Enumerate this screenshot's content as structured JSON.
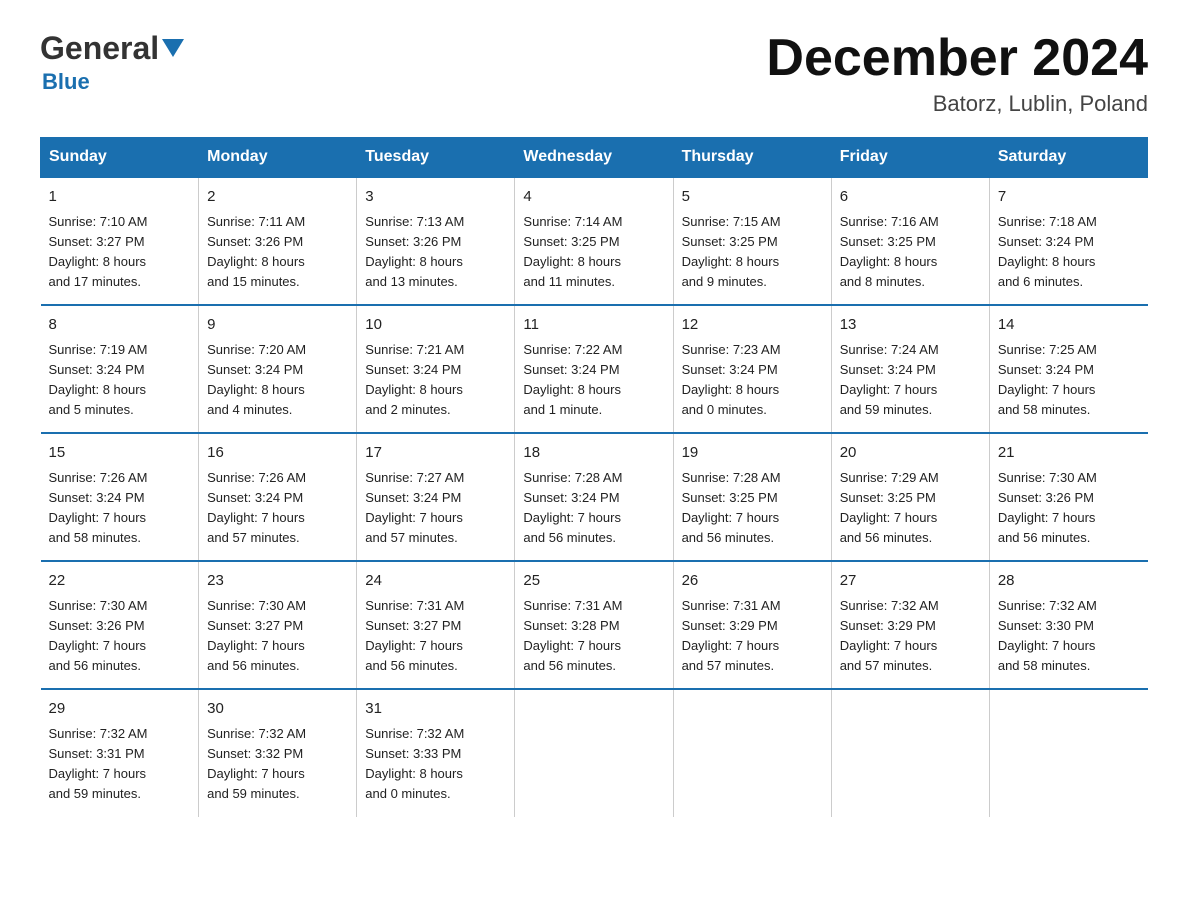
{
  "header": {
    "logo_general": "General",
    "logo_blue": "Blue",
    "month_title": "December 2024",
    "location": "Batorz, Lublin, Poland"
  },
  "days_of_week": [
    "Sunday",
    "Monday",
    "Tuesday",
    "Wednesday",
    "Thursday",
    "Friday",
    "Saturday"
  ],
  "weeks": [
    [
      {
        "day": "1",
        "sunrise": "7:10 AM",
        "sunset": "3:27 PM",
        "daylight": "8 hours and 17 minutes."
      },
      {
        "day": "2",
        "sunrise": "7:11 AM",
        "sunset": "3:26 PM",
        "daylight": "8 hours and 15 minutes."
      },
      {
        "day": "3",
        "sunrise": "7:13 AM",
        "sunset": "3:26 PM",
        "daylight": "8 hours and 13 minutes."
      },
      {
        "day": "4",
        "sunrise": "7:14 AM",
        "sunset": "3:25 PM",
        "daylight": "8 hours and 11 minutes."
      },
      {
        "day": "5",
        "sunrise": "7:15 AM",
        "sunset": "3:25 PM",
        "daylight": "8 hours and 9 minutes."
      },
      {
        "day": "6",
        "sunrise": "7:16 AM",
        "sunset": "3:25 PM",
        "daylight": "8 hours and 8 minutes."
      },
      {
        "day": "7",
        "sunrise": "7:18 AM",
        "sunset": "3:24 PM",
        "daylight": "8 hours and 6 minutes."
      }
    ],
    [
      {
        "day": "8",
        "sunrise": "7:19 AM",
        "sunset": "3:24 PM",
        "daylight": "8 hours and 5 minutes."
      },
      {
        "day": "9",
        "sunrise": "7:20 AM",
        "sunset": "3:24 PM",
        "daylight": "8 hours and 4 minutes."
      },
      {
        "day": "10",
        "sunrise": "7:21 AM",
        "sunset": "3:24 PM",
        "daylight": "8 hours and 2 minutes."
      },
      {
        "day": "11",
        "sunrise": "7:22 AM",
        "sunset": "3:24 PM",
        "daylight": "8 hours and 1 minute."
      },
      {
        "day": "12",
        "sunrise": "7:23 AM",
        "sunset": "3:24 PM",
        "daylight": "8 hours and 0 minutes."
      },
      {
        "day": "13",
        "sunrise": "7:24 AM",
        "sunset": "3:24 PM",
        "daylight": "7 hours and 59 minutes."
      },
      {
        "day": "14",
        "sunrise": "7:25 AM",
        "sunset": "3:24 PM",
        "daylight": "7 hours and 58 minutes."
      }
    ],
    [
      {
        "day": "15",
        "sunrise": "7:26 AM",
        "sunset": "3:24 PM",
        "daylight": "7 hours and 58 minutes."
      },
      {
        "day": "16",
        "sunrise": "7:26 AM",
        "sunset": "3:24 PM",
        "daylight": "7 hours and 57 minutes."
      },
      {
        "day": "17",
        "sunrise": "7:27 AM",
        "sunset": "3:24 PM",
        "daylight": "7 hours and 57 minutes."
      },
      {
        "day": "18",
        "sunrise": "7:28 AM",
        "sunset": "3:24 PM",
        "daylight": "7 hours and 56 minutes."
      },
      {
        "day": "19",
        "sunrise": "7:28 AM",
        "sunset": "3:25 PM",
        "daylight": "7 hours and 56 minutes."
      },
      {
        "day": "20",
        "sunrise": "7:29 AM",
        "sunset": "3:25 PM",
        "daylight": "7 hours and 56 minutes."
      },
      {
        "day": "21",
        "sunrise": "7:30 AM",
        "sunset": "3:26 PM",
        "daylight": "7 hours and 56 minutes."
      }
    ],
    [
      {
        "day": "22",
        "sunrise": "7:30 AM",
        "sunset": "3:26 PM",
        "daylight": "7 hours and 56 minutes."
      },
      {
        "day": "23",
        "sunrise": "7:30 AM",
        "sunset": "3:27 PM",
        "daylight": "7 hours and 56 minutes."
      },
      {
        "day": "24",
        "sunrise": "7:31 AM",
        "sunset": "3:27 PM",
        "daylight": "7 hours and 56 minutes."
      },
      {
        "day": "25",
        "sunrise": "7:31 AM",
        "sunset": "3:28 PM",
        "daylight": "7 hours and 56 minutes."
      },
      {
        "day": "26",
        "sunrise": "7:31 AM",
        "sunset": "3:29 PM",
        "daylight": "7 hours and 57 minutes."
      },
      {
        "day": "27",
        "sunrise": "7:32 AM",
        "sunset": "3:29 PM",
        "daylight": "7 hours and 57 minutes."
      },
      {
        "day": "28",
        "sunrise": "7:32 AM",
        "sunset": "3:30 PM",
        "daylight": "7 hours and 58 minutes."
      }
    ],
    [
      {
        "day": "29",
        "sunrise": "7:32 AM",
        "sunset": "3:31 PM",
        "daylight": "7 hours and 59 minutes."
      },
      {
        "day": "30",
        "sunrise": "7:32 AM",
        "sunset": "3:32 PM",
        "daylight": "7 hours and 59 minutes."
      },
      {
        "day": "31",
        "sunrise": "7:32 AM",
        "sunset": "3:33 PM",
        "daylight": "8 hours and 0 minutes."
      },
      null,
      null,
      null,
      null
    ]
  ],
  "labels": {
    "sunrise": "Sunrise:",
    "sunset": "Sunset:",
    "daylight": "Daylight:"
  },
  "colors": {
    "header_bg": "#1a6faf",
    "border": "#1a6faf"
  }
}
